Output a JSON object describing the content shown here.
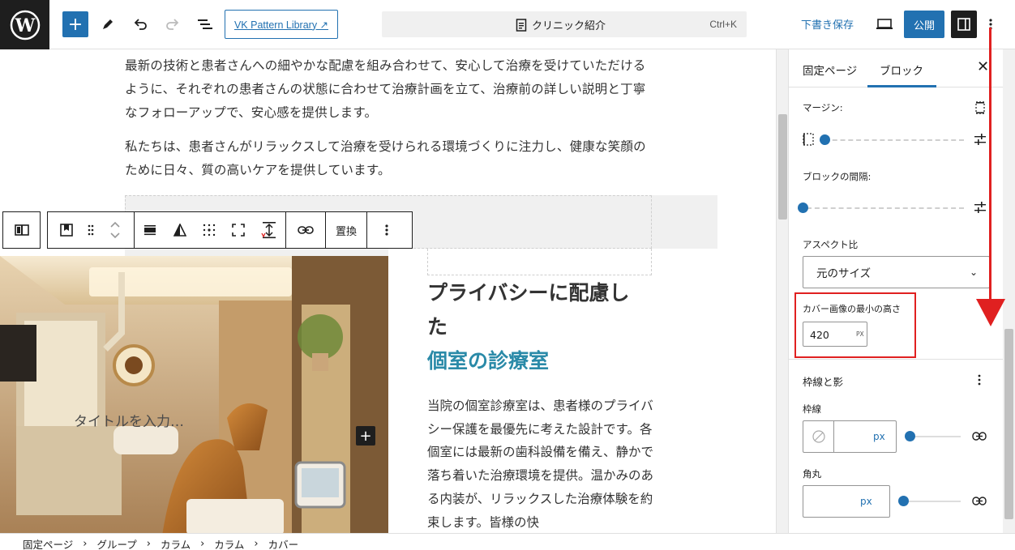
{
  "topbar": {
    "pattern_library": "VK Pattern Library ↗",
    "document_title": "クリニック紹介",
    "shortcut": "Ctrl+K",
    "save_draft": "下書き保存",
    "publish": "公開"
  },
  "content": {
    "paragraph_1": "最新の技術と患者さんへの細やかな配慮を組み合わせて、安心して治療を受けていただけるように、それぞれの患者さんの状態に合わせて治療計画を立て、治療前の詳しい説明と丁寧なフォローアップで、安心感を提供します。",
    "paragraph_2": "私たちは、患者さんがリラックスして治療を受けられる環境づくりに注力し、健康な笑顔のために日々、質の高いケアを提供しています。",
    "cover_placeholder": "タイトルを入力…",
    "heading_line1": "プライバシーに配慮した",
    "heading_line2": "個室の診療室",
    "body": "当院の個室診療室は、患者様のプライバシー保護を最優先に考えた設計です。各個室には最新の歯科設備を備え、静かで落ち着いた治療環境を提供。温かみのある内装が、リラックスした治療体験を約束します。皆様の快",
    "toolbar_replace": "置換"
  },
  "sidebar": {
    "tab_page": "固定ページ",
    "tab_block": "ブロック",
    "margin_label": "マージン:",
    "block_spacing_label": "ブロックの間隔:",
    "aspect_ratio_label": "アスペクト比",
    "aspect_ratio_value": "元のサイズ",
    "min_height_label": "カバー画像の最小の高さ",
    "min_height_value": "420",
    "min_height_unit": "PX",
    "border_shadow_title": "枠線と影",
    "border_label": "枠線",
    "border_unit": "px",
    "radius_label": "角丸",
    "radius_unit": "px"
  },
  "breadcrumb": [
    "固定ページ",
    "グループ",
    "カラム",
    "カラム",
    "カバー"
  ],
  "colors": {
    "accent": "#2271b1",
    "heading_accent": "#2a8aa8",
    "annotation": "#e02020"
  }
}
